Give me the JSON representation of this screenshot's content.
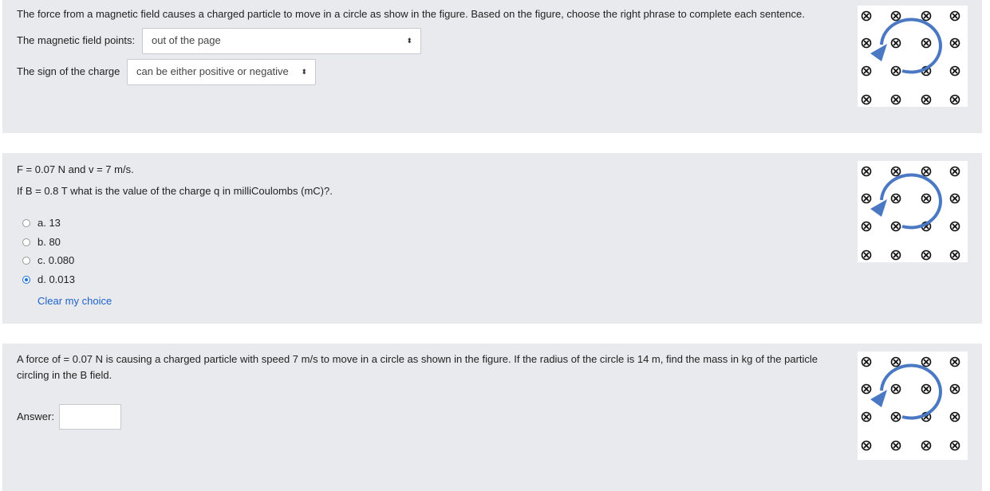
{
  "q1": {
    "prompt": "The force from a magnetic field causes a charged particle to move in a circle as show in the figure.  Based on the figure, choose the right phrase to complete each sentence.",
    "field_label": "The magnetic field points:",
    "field_value": "out of the page",
    "charge_label": "The sign of the charge",
    "charge_value": "can be either positive or negative",
    "arrow_glyph": "⬍"
  },
  "q2": {
    "line1": "F = 0.07 N and v = 7 m/s.",
    "line2": "If B = 0.8 T what is the value of the charge q in milliCoulombs (mC)?.",
    "options": [
      {
        "label": "a. 13",
        "selected": false
      },
      {
        "label": "b. 80",
        "selected": false
      },
      {
        "label": "c. 0.080",
        "selected": false
      },
      {
        "label": "d. 0.013",
        "selected": true
      }
    ],
    "clear_label": "Clear my choice"
  },
  "q3": {
    "line1": "A force of = 0.07 N is causing a charged particle with speed 7 m/s to move in a circle as shown in the figure.  If the radius of the circle is 14 m, find the mass in kg of the particle",
    "line2": "circling in the B field.",
    "answer_label": "Answer:",
    "answer_value": ""
  },
  "figure": {
    "field_symbol": "into-page-x-icon",
    "arrow_color": "#4a78c2"
  }
}
